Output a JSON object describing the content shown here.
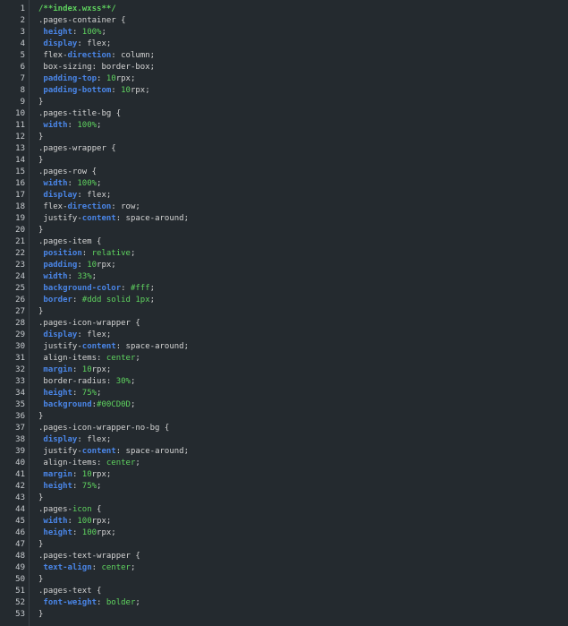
{
  "editor": {
    "file": "index.wxss",
    "colors": {
      "background": "#242a2f",
      "gutter_border": "#3a4147",
      "line_number": "#c8ccd0",
      "text": "#d4d4d4",
      "comment": "#5fd35f",
      "property": "#4a86e8",
      "value": "#5fd35f"
    },
    "lines": [
      {
        "n": "1",
        "tokens": [
          [
            "comment",
            "/**index.wxss**/"
          ]
        ]
      },
      {
        "n": "2",
        "tokens": [
          [
            "default",
            ".pages-container {"
          ]
        ]
      },
      {
        "n": "3",
        "tokens": [
          [
            "default",
            " "
          ],
          [
            "prop",
            "height"
          ],
          [
            "default",
            ": "
          ],
          [
            "value",
            "100%"
          ],
          [
            "default",
            ";"
          ]
        ]
      },
      {
        "n": "4",
        "tokens": [
          [
            "default",
            " "
          ],
          [
            "prop",
            "display"
          ],
          [
            "default",
            ": flex;"
          ]
        ]
      },
      {
        "n": "5",
        "tokens": [
          [
            "default",
            " flex-"
          ],
          [
            "prop",
            "direction"
          ],
          [
            "default",
            ": column;"
          ]
        ]
      },
      {
        "n": "6",
        "tokens": [
          [
            "default",
            " box-sizing: border-box;"
          ]
        ]
      },
      {
        "n": "7",
        "tokens": [
          [
            "default",
            " "
          ],
          [
            "prop",
            "padding-top"
          ],
          [
            "default",
            ": "
          ],
          [
            "value",
            "10"
          ],
          [
            "default",
            "rpx;"
          ]
        ]
      },
      {
        "n": "8",
        "tokens": [
          [
            "default",
            " "
          ],
          [
            "prop",
            "padding-bottom"
          ],
          [
            "default",
            ": "
          ],
          [
            "value",
            "10"
          ],
          [
            "default",
            "rpx;"
          ]
        ]
      },
      {
        "n": "9",
        "tokens": [
          [
            "default",
            "}"
          ]
        ]
      },
      {
        "n": "10",
        "tokens": [
          [
            "default",
            ".pages-title-bg {"
          ]
        ]
      },
      {
        "n": "11",
        "tokens": [
          [
            "default",
            " "
          ],
          [
            "prop",
            "width"
          ],
          [
            "default",
            ": "
          ],
          [
            "value",
            "100%"
          ],
          [
            "default",
            ";"
          ]
        ]
      },
      {
        "n": "12",
        "tokens": [
          [
            "default",
            "}"
          ]
        ]
      },
      {
        "n": "13",
        "tokens": [
          [
            "default",
            ".pages-wrapper {"
          ]
        ]
      },
      {
        "n": "14",
        "tokens": [
          [
            "default",
            "}"
          ]
        ]
      },
      {
        "n": "15",
        "tokens": [
          [
            "default",
            ".pages-row {"
          ]
        ]
      },
      {
        "n": "16",
        "tokens": [
          [
            "default",
            " "
          ],
          [
            "prop",
            "width"
          ],
          [
            "default",
            ": "
          ],
          [
            "value",
            "100%"
          ],
          [
            "default",
            ";"
          ]
        ]
      },
      {
        "n": "17",
        "tokens": [
          [
            "default",
            " "
          ],
          [
            "prop",
            "display"
          ],
          [
            "default",
            ": flex;"
          ]
        ]
      },
      {
        "n": "18",
        "tokens": [
          [
            "default",
            " flex-"
          ],
          [
            "prop",
            "direction"
          ],
          [
            "default",
            ": row;"
          ]
        ]
      },
      {
        "n": "19",
        "tokens": [
          [
            "default",
            " justify-"
          ],
          [
            "prop",
            "content"
          ],
          [
            "default",
            ": space-around;"
          ]
        ]
      },
      {
        "n": "20",
        "tokens": [
          [
            "default",
            "}"
          ]
        ]
      },
      {
        "n": "21",
        "tokens": [
          [
            "default",
            ".pages-item {"
          ]
        ]
      },
      {
        "n": "22",
        "tokens": [
          [
            "default",
            " "
          ],
          [
            "prop",
            "position"
          ],
          [
            "default",
            ": "
          ],
          [
            "value",
            "relative"
          ],
          [
            "default",
            ";"
          ]
        ]
      },
      {
        "n": "23",
        "tokens": [
          [
            "default",
            " "
          ],
          [
            "prop",
            "padding"
          ],
          [
            "default",
            ": "
          ],
          [
            "value",
            "10"
          ],
          [
            "default",
            "rpx;"
          ]
        ]
      },
      {
        "n": "24",
        "tokens": [
          [
            "default",
            " "
          ],
          [
            "prop",
            "width"
          ],
          [
            "default",
            ": "
          ],
          [
            "value",
            "33%"
          ],
          [
            "default",
            ";"
          ]
        ]
      },
      {
        "n": "25",
        "tokens": [
          [
            "default",
            " "
          ],
          [
            "prop",
            "background-color"
          ],
          [
            "default",
            ": "
          ],
          [
            "value",
            "#fff"
          ],
          [
            "default",
            ";"
          ]
        ]
      },
      {
        "n": "26",
        "tokens": [
          [
            "default",
            " "
          ],
          [
            "prop",
            "border"
          ],
          [
            "default",
            ": "
          ],
          [
            "value",
            "#ddd solid 1px"
          ],
          [
            "default",
            ";"
          ]
        ]
      },
      {
        "n": "27",
        "tokens": [
          [
            "default",
            "}"
          ]
        ]
      },
      {
        "n": "28",
        "tokens": [
          [
            "default",
            ".pages-icon-wrapper {"
          ]
        ]
      },
      {
        "n": "29",
        "tokens": [
          [
            "default",
            " "
          ],
          [
            "prop",
            "display"
          ],
          [
            "default",
            ": flex;"
          ]
        ]
      },
      {
        "n": "30",
        "tokens": [
          [
            "default",
            " justify-"
          ],
          [
            "prop",
            "content"
          ],
          [
            "default",
            ": space-around;"
          ]
        ]
      },
      {
        "n": "31",
        "tokens": [
          [
            "default",
            " align-items: "
          ],
          [
            "value",
            "center"
          ],
          [
            "default",
            ";"
          ]
        ]
      },
      {
        "n": "32",
        "tokens": [
          [
            "default",
            " "
          ],
          [
            "prop",
            "margin"
          ],
          [
            "default",
            ": "
          ],
          [
            "value",
            "10"
          ],
          [
            "default",
            "rpx;"
          ]
        ]
      },
      {
        "n": "33",
        "tokens": [
          [
            "default",
            " border-radius: "
          ],
          [
            "value",
            "30%"
          ],
          [
            "default",
            ";"
          ]
        ]
      },
      {
        "n": "34",
        "tokens": [
          [
            "default",
            " "
          ],
          [
            "prop",
            "height"
          ],
          [
            "default",
            ": "
          ],
          [
            "value",
            "75%"
          ],
          [
            "default",
            ";"
          ]
        ]
      },
      {
        "n": "35",
        "tokens": [
          [
            "default",
            " "
          ],
          [
            "prop",
            "background"
          ],
          [
            "default",
            ":"
          ],
          [
            "value",
            "#00CD0D"
          ],
          [
            "default",
            ";"
          ]
        ]
      },
      {
        "n": "36",
        "tokens": [
          [
            "default",
            "}"
          ]
        ]
      },
      {
        "n": "37",
        "tokens": [
          [
            "default",
            ".pages-icon-wrapper-no-bg {"
          ]
        ]
      },
      {
        "n": "38",
        "tokens": [
          [
            "default",
            " "
          ],
          [
            "prop",
            "display"
          ],
          [
            "default",
            ": flex;"
          ]
        ]
      },
      {
        "n": "39",
        "tokens": [
          [
            "default",
            " justify-"
          ],
          [
            "prop",
            "content"
          ],
          [
            "default",
            ": space-around;"
          ]
        ]
      },
      {
        "n": "40",
        "tokens": [
          [
            "default",
            " align-items: "
          ],
          [
            "value",
            "center"
          ],
          [
            "default",
            ";"
          ]
        ]
      },
      {
        "n": "41",
        "tokens": [
          [
            "default",
            " "
          ],
          [
            "prop",
            "margin"
          ],
          [
            "default",
            ": "
          ],
          [
            "value",
            "10"
          ],
          [
            "default",
            "rpx;"
          ]
        ]
      },
      {
        "n": "42",
        "tokens": [
          [
            "default",
            " "
          ],
          [
            "prop",
            "height"
          ],
          [
            "default",
            ": "
          ],
          [
            "value",
            "75%"
          ],
          [
            "default",
            ";"
          ]
        ]
      },
      {
        "n": "43",
        "tokens": [
          [
            "default",
            "}"
          ]
        ]
      },
      {
        "n": "44",
        "tokens": [
          [
            "default",
            ".pages-"
          ],
          [
            "value",
            "icon"
          ],
          [
            "default",
            " {"
          ]
        ]
      },
      {
        "n": "45",
        "tokens": [
          [
            "default",
            " "
          ],
          [
            "prop",
            "width"
          ],
          [
            "default",
            ": "
          ],
          [
            "value",
            "100"
          ],
          [
            "default",
            "rpx;"
          ]
        ]
      },
      {
        "n": "46",
        "tokens": [
          [
            "default",
            " "
          ],
          [
            "prop",
            "height"
          ],
          [
            "default",
            ": "
          ],
          [
            "value",
            "100"
          ],
          [
            "default",
            "rpx;"
          ]
        ]
      },
      {
        "n": "47",
        "tokens": [
          [
            "default",
            "}"
          ]
        ]
      },
      {
        "n": "48",
        "tokens": [
          [
            "default",
            ".pages-text-wrapper {"
          ]
        ]
      },
      {
        "n": "49",
        "tokens": [
          [
            "default",
            " "
          ],
          [
            "prop",
            "text-align"
          ],
          [
            "default",
            ": "
          ],
          [
            "value",
            "center"
          ],
          [
            "default",
            ";"
          ]
        ]
      },
      {
        "n": "50",
        "tokens": [
          [
            "default",
            "}"
          ]
        ]
      },
      {
        "n": "51",
        "tokens": [
          [
            "default",
            ".pages-text {"
          ]
        ]
      },
      {
        "n": "52",
        "tokens": [
          [
            "default",
            " "
          ],
          [
            "prop",
            "font-weight"
          ],
          [
            "default",
            ": "
          ],
          [
            "value",
            "bolder"
          ],
          [
            "default",
            ";"
          ]
        ]
      },
      {
        "n": "53",
        "tokens": [
          [
            "default",
            "}"
          ]
        ]
      }
    ]
  }
}
